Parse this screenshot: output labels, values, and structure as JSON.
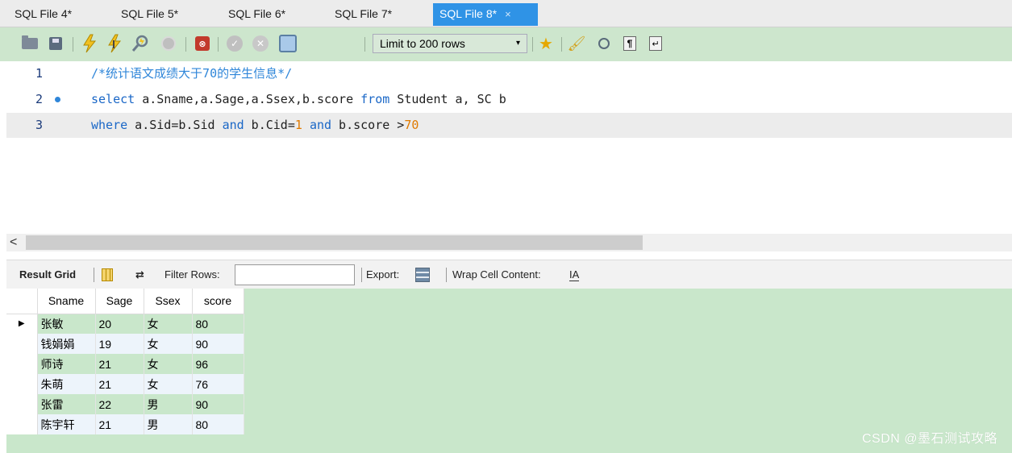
{
  "tabs": [
    {
      "label": "SQL File 4*"
    },
    {
      "label": "SQL File 5*"
    },
    {
      "label": "SQL File 6*"
    },
    {
      "label": "SQL File 7*"
    },
    {
      "label": "SQL File 8*",
      "active": true
    }
  ],
  "tab_close_glyph": "×",
  "toolbar": {
    "limit_select": "Limit to 200 rows",
    "caret": "▾"
  },
  "editor": {
    "lines": [
      {
        "num": "1",
        "comment": "/*统计语文成绩大于70的学生信息*/"
      },
      {
        "num": "2",
        "kw1": "select",
        "t1": " a.Sname,a.Sage,a.Ssex,b.score ",
        "kw2": "from",
        "t2": " Student a, SC b"
      },
      {
        "num": "3",
        "kw1": "where",
        "t1": " a.Sid=b.Sid ",
        "kw2": "and",
        "t2": " b.Cid=",
        "n1": "1",
        "t3": " ",
        "kw3": "and",
        "t4": " b.score >",
        "n2": "70"
      }
    ]
  },
  "scroll_arrow": "<",
  "result_toolbar": {
    "result_grid": "Result Grid",
    "filter_rows": "Filter Rows:",
    "filter_value": "",
    "export": "Export:",
    "wrap_cell": "Wrap Cell Content:",
    "wrap_icon_text": "IA"
  },
  "grid": {
    "columns": [
      "Sname",
      "Sage",
      "Ssex",
      "score"
    ],
    "row_marker": "▶",
    "rows": [
      [
        "张敏",
        "20",
        "女",
        "80"
      ],
      [
        "钱娟娟",
        "19",
        "女",
        "90"
      ],
      [
        "师诗",
        "21",
        "女",
        "96"
      ],
      [
        "朱萌",
        "21",
        "女",
        "76"
      ],
      [
        "张雷",
        "22",
        "男",
        "90"
      ],
      [
        "陈宇轩",
        "21",
        "男",
        "80"
      ]
    ]
  },
  "watermark": "CSDN @墨石测试攻略"
}
